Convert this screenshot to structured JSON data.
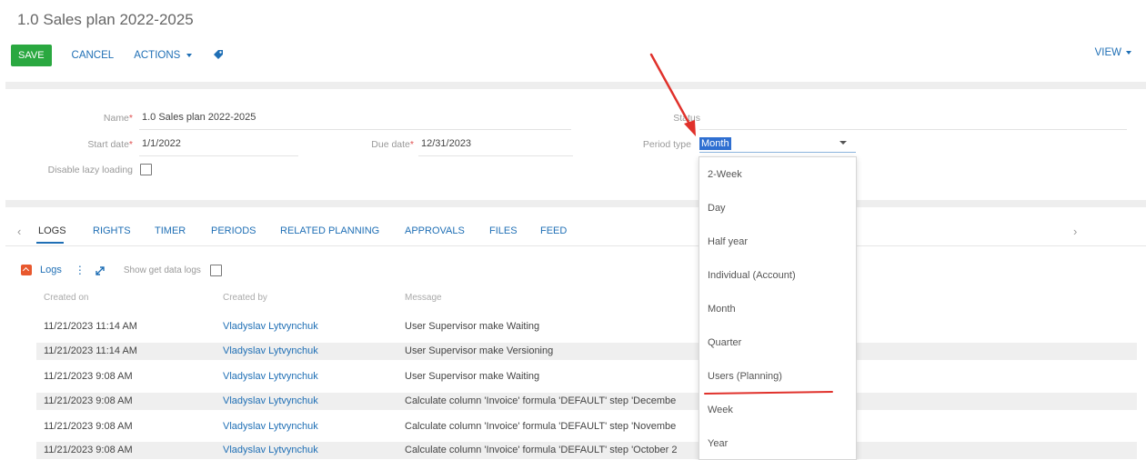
{
  "page": {
    "title": "1.0 Sales plan 2022-2025"
  },
  "toolbar": {
    "save_label": "SAVE",
    "cancel_label": "CANCEL",
    "actions_label": "ACTIONS",
    "view_label": "VIEW",
    "tag_icon": "tag-icon"
  },
  "form": {
    "name_label": "Name",
    "name_value": "1.0 Sales plan 2022-2025",
    "status_label": "Status",
    "start_date_label": "Start date",
    "start_date_value": "1/1/2022",
    "due_date_label": "Due date",
    "due_date_value": "12/31/2023",
    "period_type_label": "Period type",
    "period_type_value": "Month",
    "disable_lazy_label": "Disable lazy loading",
    "required_mark": "*"
  },
  "dropdown": {
    "options": [
      "2-Week",
      "Day",
      "Half year",
      "Individual (Account)",
      "Month",
      "Quarter",
      "Users (Planning)",
      "Week",
      "Year"
    ],
    "highlight_color": "#e0312b"
  },
  "tabs": [
    "LOGS",
    "RIGHTS",
    "TIMER",
    "PERIODS",
    "RELATED PLANNING",
    "APPROVALS",
    "FILES",
    "FEED"
  ],
  "tab_nav": {
    "prev": "‹",
    "next": "›"
  },
  "logs": {
    "title": "Logs",
    "menu": "⋮",
    "show_get_data_logs_label": "Show get data logs",
    "columns": [
      "Created on",
      "Created by",
      "Message"
    ],
    "rows": [
      [
        "11/21/2023 11:14 AM",
        "Vladyslav Lytvynchuk",
        "User Supervisor make Waiting"
      ],
      [
        "11/21/2023 11:14 AM",
        "Vladyslav Lytvynchuk",
        "User Supervisor make Versioning"
      ],
      [
        "11/21/2023 9:08 AM",
        "Vladyslav Lytvynchuk",
        "User Supervisor make Waiting"
      ],
      [
        "11/21/2023 9:08 AM",
        "Vladyslav Lytvynchuk",
        "Calculate column 'Invoice' formula 'DEFAULT' step 'Decembe"
      ],
      [
        "11/21/2023 9:08 AM",
        "Vladyslav Lytvynchuk",
        "Calculate column 'Invoice' formula 'DEFAULT' step 'Novembe"
      ],
      [
        "11/21/2023 9:08 AM",
        "Vladyslav Lytvynchuk",
        "Calculate column 'Invoice' formula 'DEFAULT' step 'October 2"
      ]
    ]
  },
  "colors": {
    "accent": "#1f6fb5",
    "save": "#2aa840",
    "annotation": "#e0312b"
  }
}
